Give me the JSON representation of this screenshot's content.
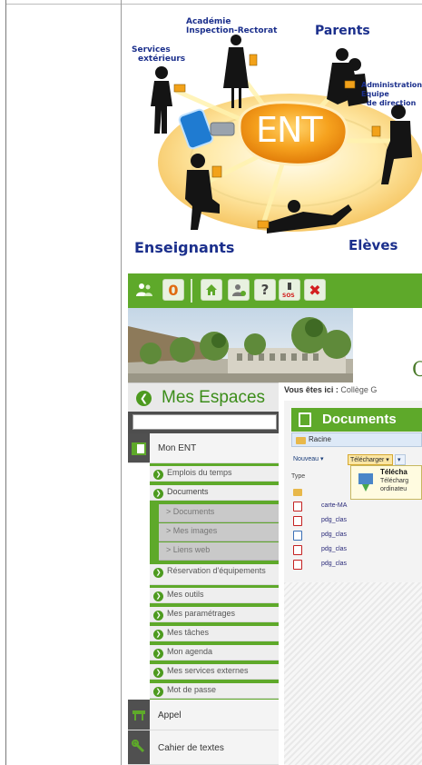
{
  "illustration": {
    "labels": {
      "academie": "Académie",
      "inspection": "Inspection-Rectorat",
      "parents": "Parents",
      "services_1": "Services",
      "services_2": "extérieurs",
      "admin_1": "Administration",
      "admin_2": "Equipe",
      "admin_3": "de direction",
      "ent": "ENT",
      "enseignants": "Enseignants",
      "eleves": "Elèves"
    },
    "colors": {
      "label": "#1b2f8c",
      "ent_orange": "#f18a10",
      "disc": "#ffe9a6"
    }
  },
  "ent_screen": {
    "toolbar": {
      "counter": "0",
      "sos": "SOS",
      "icons": [
        "users-icon",
        "counter-badge",
        "home-icon",
        "profile-icon",
        "help-icon",
        "sos-icon",
        "close-icon"
      ]
    },
    "banner_letter": "C",
    "sidebar": {
      "title": "Mes Espaces",
      "search_placeholder": "",
      "items": [
        {
          "label": "Mon ENT",
          "level": "top",
          "icon": "ent-icon"
        },
        {
          "label": "Emplois du temps",
          "level": "sub"
        },
        {
          "label": "Documents",
          "level": "sub"
        },
        {
          "label": "> Documents",
          "level": "subsub"
        },
        {
          "label": "> Mes images",
          "level": "subsub"
        },
        {
          "label": "> Liens web",
          "level": "subsub"
        },
        {
          "label": "Réservation d'équipements",
          "level": "sub"
        },
        {
          "label": "Mes outils",
          "level": "sub"
        },
        {
          "label": "Mes paramétrages",
          "level": "sub"
        },
        {
          "label": "Mes tâches",
          "level": "sub"
        },
        {
          "label": "Mon agenda",
          "level": "sub"
        },
        {
          "label": "Mes services externes",
          "level": "sub"
        },
        {
          "label": "Mot de passe",
          "level": "sub"
        },
        {
          "label": "Appel",
          "level": "top",
          "icon": "appel-icon"
        },
        {
          "label": "Cahier de textes",
          "level": "top",
          "icon": "wrench-icon"
        }
      ]
    },
    "breadcrumb": {
      "prefix": "Vous êtes ici :",
      "path": "Collège G"
    },
    "documents": {
      "title": "Documents",
      "root": "Racine",
      "nouveau": "Nouveau",
      "telecharger": "Télécharger",
      "tooltip_title": "Télécha",
      "tooltip_line1": "Télécharg",
      "tooltip_line2": "ordinateu",
      "type_header": "Type",
      "files": [
        {
          "type": "folder",
          "name": ""
        },
        {
          "type": "pdf",
          "name": "carte-MA"
        },
        {
          "type": "pdf",
          "name": "pdg_clas"
        },
        {
          "type": "doc",
          "name": "pdg_clas"
        },
        {
          "type": "pdf",
          "name": "pdg_clas"
        },
        {
          "type": "pdf",
          "name": "pdg_clas"
        }
      ]
    },
    "colors": {
      "green": "#5ea92a",
      "dark_gutter": "#505050"
    }
  }
}
